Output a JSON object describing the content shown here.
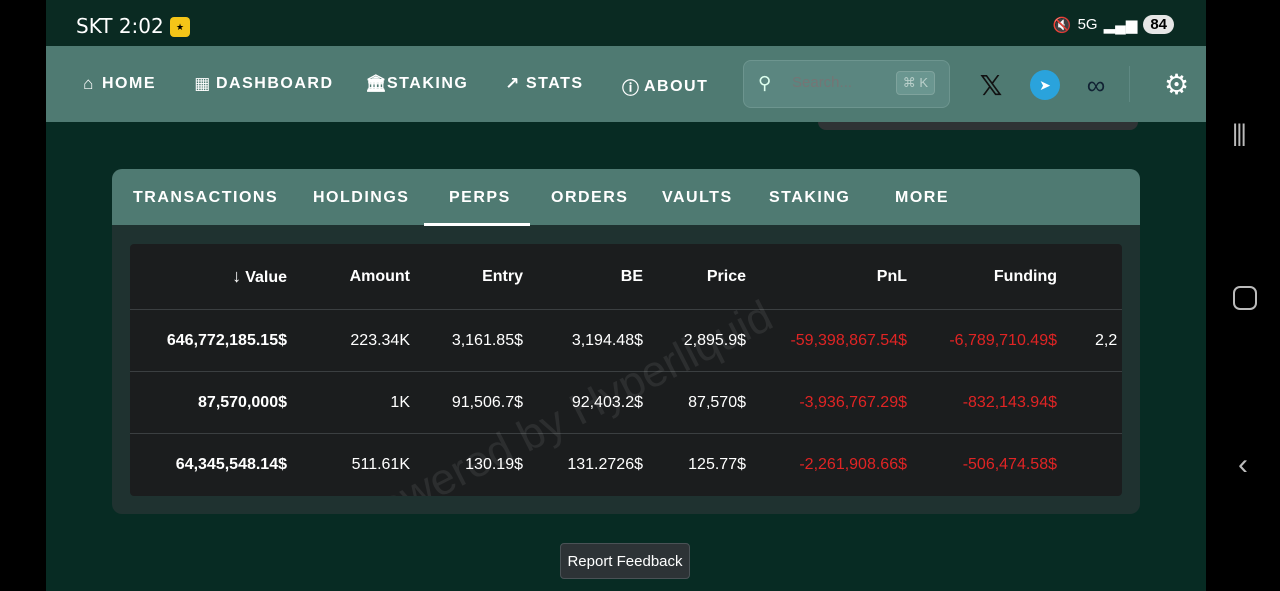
{
  "status_bar": {
    "time": "SKT 2:02",
    "battery": "84",
    "icons": [
      "mute-icon",
      "5g-icon",
      "signal-icon",
      "battery-icon"
    ]
  },
  "nav": {
    "items": [
      {
        "label": "HOME",
        "icon": "home-icon"
      },
      {
        "label": "DASHBOARD",
        "icon": "dashboard-icon"
      },
      {
        "label": "STAKING",
        "icon": "bank-icon"
      },
      {
        "label": "STATS",
        "icon": "trend-icon"
      },
      {
        "label": "ABOUT",
        "icon": "info-icon"
      }
    ],
    "search": {
      "placeholder": "Search...",
      "shortcut": "⌘ K"
    },
    "social": [
      "x-icon",
      "telegram-icon",
      "hyperliquid-icon"
    ]
  },
  "tabs": [
    "TRANSACTIONS",
    "HOLDINGS",
    "PERPS",
    "ORDERS",
    "VAULTS",
    "STAKING",
    "MORE"
  ],
  "active_tab": "PERPS",
  "table": {
    "columns": [
      "Value",
      "Amount",
      "Entry",
      "BE",
      "Price",
      "PnL",
      "Funding"
    ],
    "rows": [
      {
        "value": "646,772,185.15$",
        "amount": "223.34K",
        "entry": "3,161.85$",
        "be": "3,194.48$",
        "price": "2,895.9$",
        "pnl": "-59,398,867.54$",
        "funding": "-6,789,710.49$",
        "extra": "2,2"
      },
      {
        "value": "87,570,000$",
        "amount": "1K",
        "entry": "91,506.7$",
        "be": "92,403.2$",
        "price": "87,570$",
        "pnl": "-3,936,767.29$",
        "funding": "-832,143.94$",
        "extra": ""
      },
      {
        "value": "64,345,548.14$",
        "amount": "511.61K",
        "entry": "130.19$",
        "be": "131.2726$",
        "price": "125.77$",
        "pnl": "-2,261,908.66$",
        "funding": "-506,474.58$",
        "extra": ""
      }
    ]
  },
  "watermark": "Powered by Hyperliquid",
  "feedback_label": "Report Feedback",
  "colors": {
    "nav_bg": "#4f7a72",
    "page_bg": "#072b23",
    "negative": "#e02424"
  }
}
